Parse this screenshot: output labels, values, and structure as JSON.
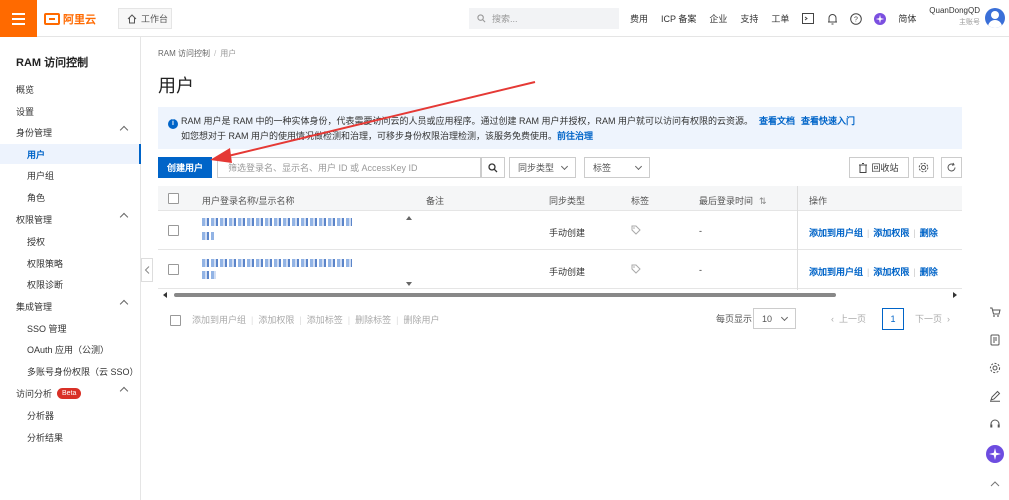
{
  "topbar": {
    "logo_text": "阿里云",
    "workbench": "工作台",
    "search_placeholder": "搜索...",
    "nav": [
      "费用",
      "ICP 备案",
      "企业",
      "支持",
      "工单"
    ],
    "lang": "简体",
    "user_name": "QuanDongQD",
    "user_role": "主账号",
    "brand_color": "#ff6a00"
  },
  "sidebar": {
    "title": "RAM 访问控制",
    "items": [
      {
        "label": "概览",
        "type": "top"
      },
      {
        "label": "设置",
        "type": "top"
      },
      {
        "label": "身份管理",
        "type": "group"
      },
      {
        "label": "用户",
        "type": "sub",
        "active": true
      },
      {
        "label": "用户组",
        "type": "sub"
      },
      {
        "label": "角色",
        "type": "sub"
      },
      {
        "label": "权限管理",
        "type": "group"
      },
      {
        "label": "授权",
        "type": "sub"
      },
      {
        "label": "权限策略",
        "type": "sub"
      },
      {
        "label": "权限诊断",
        "type": "sub"
      },
      {
        "label": "集成管理",
        "type": "group"
      },
      {
        "label": "SSO 管理",
        "type": "sub"
      },
      {
        "label": "OAuth 应用（公测）",
        "type": "sub"
      },
      {
        "label": "多账号身份权限（云 SSO）",
        "type": "sub"
      },
      {
        "label": "访问分析",
        "type": "group",
        "badge": "Beta"
      },
      {
        "label": "分析器",
        "type": "sub"
      },
      {
        "label": "分析结果",
        "type": "sub"
      }
    ]
  },
  "breadcrumb": [
    "RAM 访问控制",
    "用户"
  ],
  "page_title": "用户",
  "notice": {
    "line1": "RAM 用户是 RAM 中的一种实体身份，代表需要访问云的人员或应用程序。通过创建 RAM 用户并授权，RAM 用户就可以访问有权限的云资源。",
    "link1": "查看文档",
    "link2": "查看快速入门",
    "line2": "如您想对于 RAM 用户的使用情况做检测和治理，可移步身份权限治理检测，该服务免费使用。",
    "link3": "前往治理"
  },
  "toolbar": {
    "create_button": "创建用户",
    "filter_placeholder": "筛选登录名、显示名、用户 ID 或 AccessKey ID",
    "sync_select": "同步类型",
    "tag_select": "标签",
    "recycle_button": "回收站"
  },
  "table": {
    "columns": [
      "用户登录名称/显示名称",
      "备注",
      "同步类型",
      "标签",
      "最后登录时间",
      "操作"
    ],
    "rows": [
      {
        "remark": "",
        "sync_type": "手动创建",
        "last_login": "-",
        "actions": [
          "添加到用户组",
          "添加权限",
          "删除"
        ]
      },
      {
        "remark": "",
        "sync_type": "手动创建",
        "last_login": "-",
        "actions": [
          "添加到用户组",
          "添加权限",
          "删除"
        ]
      }
    ]
  },
  "batch_actions": [
    "添加到用户组",
    "添加权限",
    "添加标签",
    "删除标签",
    "删除用户"
  ],
  "pagination": {
    "per_page_label": "每页显示",
    "per_page": "10",
    "prev": "上一页",
    "current": "1",
    "next": "下一页"
  },
  "colors": {
    "primary": "#0064c8",
    "annotation_arrow": "#e53935"
  }
}
